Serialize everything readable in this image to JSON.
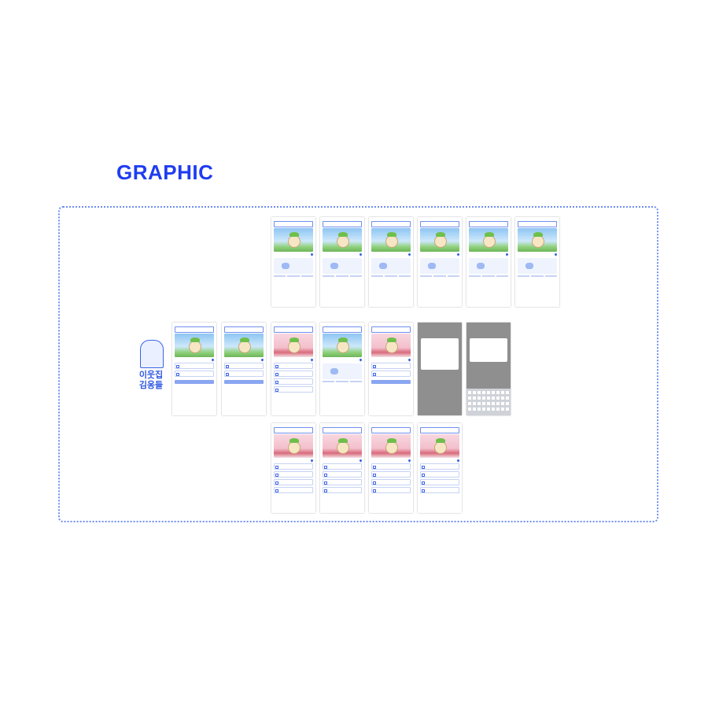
{
  "heading": "GRAPHIC",
  "logo": {
    "line1": "이웃집",
    "line2": "김옹들",
    "tagline": ""
  },
  "accent": "#1f3df0",
  "frame_color": "#6f8ff0",
  "screen_groups": {
    "row1_count": 6,
    "row2_count": 7,
    "row3_count": 4
  }
}
